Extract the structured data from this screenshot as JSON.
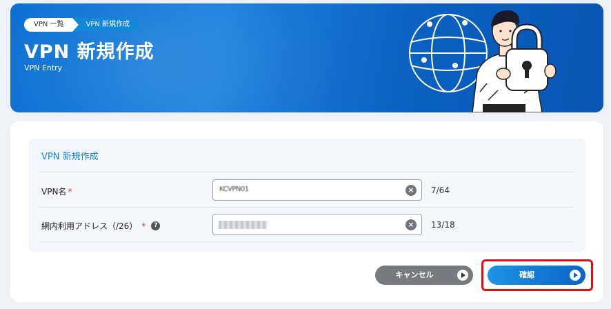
{
  "header": {
    "breadcrumb": [
      "VPN 一覧",
      "VPN 新規作成"
    ],
    "title": "VPN 新規作成",
    "subtitle": "VPN Entry"
  },
  "form": {
    "section_title": "VPN 新規作成",
    "fields": [
      {
        "label": "VPN名",
        "required_mark": "*",
        "value": "KCVPN01",
        "counter": "7/64",
        "clear_icon": "close-icon"
      },
      {
        "label": "網内利用アドレス（/26）",
        "required_mark": "*",
        "help": "?",
        "value": "",
        "counter": "13/18",
        "clear_icon": "close-icon"
      }
    ]
  },
  "actions": {
    "cancel_label": "キャンセル",
    "confirm_label": "確認"
  },
  "colors": {
    "accent": "#1587d8",
    "required": "#e0352b",
    "highlight": "#e00d12"
  }
}
